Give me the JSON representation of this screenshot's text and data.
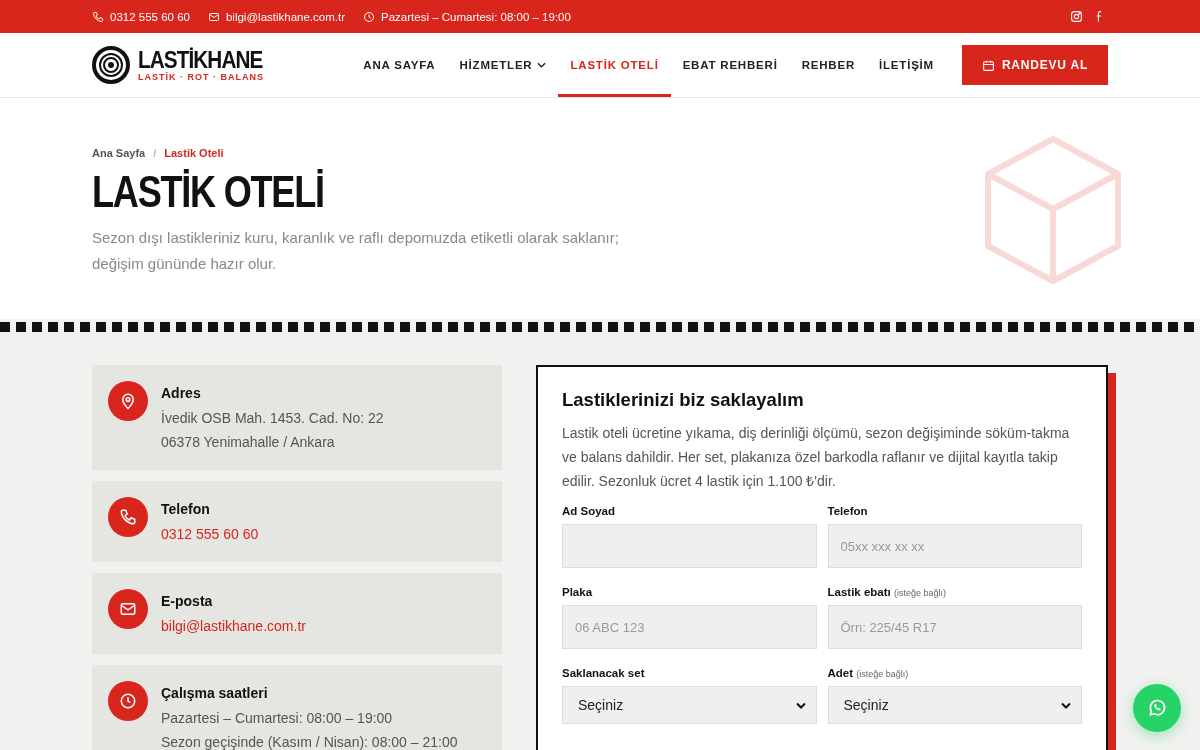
{
  "topbar": {
    "phone": "0312 555 60 60",
    "email": "bilgi@lastikhane.com.tr",
    "hours": "Pazartesi – Cumartesi: 08:00 – 19:00"
  },
  "brand": {
    "name": "LASTİKHANE",
    "tagline": "LASTİK · ROT · BALANS"
  },
  "nav": [
    {
      "label": "ANA SAYFA",
      "selected": false,
      "dropdown": false
    },
    {
      "label": "HİZMETLER",
      "selected": false,
      "dropdown": true
    },
    {
      "label": "LASTİK OTELİ",
      "selected": true,
      "dropdown": false
    },
    {
      "label": "EBAT REHBERİ",
      "selected": false,
      "dropdown": false
    },
    {
      "label": "REHBER",
      "selected": false,
      "dropdown": false
    },
    {
      "label": "İLETİŞİM",
      "selected": false,
      "dropdown": false
    }
  ],
  "cta": "RANDEVU AL",
  "breadcrumb_separator": "/",
  "breadcrumb": [
    {
      "label": "Ana Sayfa",
      "current": false
    },
    {
      "label": "Lastik Oteli",
      "current": true
    }
  ],
  "hero": {
    "title": "LASTİK OTELİ",
    "description": "Sezon dışı lastikleriniz kuru, karanlık ve raflı depomuzda etiketli olarak saklanır; değişim gününde hazır olur."
  },
  "contact_cards": [
    {
      "kind": "address",
      "title": "Adres",
      "linked": false,
      "lines": [
        "İvedik OSB Mah. 1453. Cad. No: 22",
        "06378 Yenimahalle / Ankara"
      ]
    },
    {
      "kind": "phone",
      "title": "Telefon",
      "linked": true,
      "lines": [
        "0312 555 60 60"
      ]
    },
    {
      "kind": "email",
      "title": "E-posta",
      "linked": true,
      "lines": [
        "bilgi@lastikhane.com.tr"
      ]
    },
    {
      "kind": "hours",
      "title": "Çalışma saatleri",
      "linked": false,
      "lines": [
        "Pazartesi – Cumartesi: 08:00 – 19:00",
        "Sezon geçişinde (Kasım / Nisan): 08:00 – 21:00"
      ]
    }
  ],
  "form": {
    "title": "Lastiklerinizi biz saklayalım",
    "description": "Lastik oteli ücretine yıkama, diş derinliği ölçümü, sezon değişiminde söküm-takma ve balans dahildir. Her set, plakanıza özel barkodla raflanır ve dijital kayıtla takip edilir. Sezonluk ücret 4 lastik için 1.100 ₺'dir.",
    "fields": [
      {
        "kind": "input",
        "label": "Ad Soyad"
      },
      {
        "kind": "input",
        "label": "Telefon",
        "placeholder": "05xx xxx xx xx"
      },
      {
        "kind": "input",
        "label": "Plaka",
        "placeholder": "06 ABC 123"
      },
      {
        "kind": "input",
        "label": "Lastik ebatı",
        "note": "(isteğe bağlı)",
        "placeholder": "Örn: 225/45 R17"
      },
      {
        "kind": "select",
        "label": "Saklanacak set",
        "value": "Seçiniz"
      },
      {
        "kind": "select",
        "label": "Adet",
        "note": "(isteğe bağlı)",
        "value": "Seçiniz"
      }
    ]
  }
}
